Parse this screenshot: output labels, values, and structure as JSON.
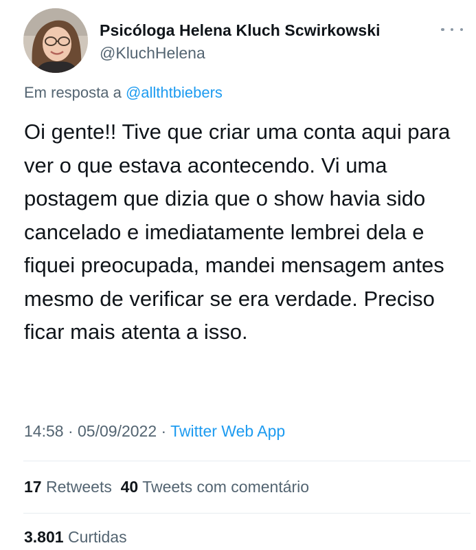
{
  "author": {
    "display_name": "Psicóloga Helena Kluch Scwirkowski",
    "handle": "@KluchHelena"
  },
  "reply": {
    "prefix": "Em resposta a ",
    "mention": "@allthtbiebers"
  },
  "tweet": {
    "text": "Oi gente!! Tive que criar uma conta aqui para ver o que estava acontecendo. Vi uma postagem que dizia que o show havia sido cancelado e imediatamente lembrei dela e fiquei preocupada, mandei mensagem antes mesmo de verificar se era verdade. Preciso ficar mais atenta a isso.",
    "time": "14:58",
    "separator": " · ",
    "date": "05/09/2022",
    "source": "Twitter Web App"
  },
  "stats": {
    "retweets_count": "17",
    "retweets_label": " Retweets",
    "quotes_count": "40",
    "quotes_label": " Tweets com comentário",
    "likes_count": "3.801",
    "likes_label": " Curtidas"
  },
  "icons": {
    "more": "more-horizontal-icon"
  },
  "colors": {
    "link": "#1d9bf0",
    "secondary_text": "#536471",
    "primary_text": "#0f1419",
    "divider": "#e6ecf0"
  }
}
